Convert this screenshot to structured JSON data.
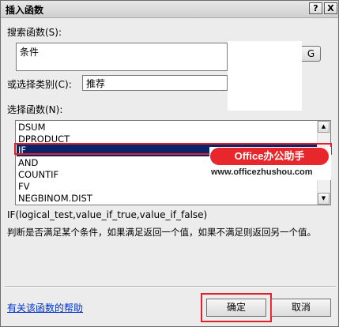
{
  "window": {
    "title": "插入函数",
    "help_glyph": "?",
    "close_glyph": "X"
  },
  "search": {
    "label": "搜索函数(S):",
    "value": "条件",
    "go_label": "G"
  },
  "category": {
    "label": "或选择类别(C):",
    "selected": "推荐"
  },
  "functions": {
    "label": "选择函数(N):",
    "items": [
      "DSUM",
      "DPRODUCT",
      "IF",
      "AND",
      "COUNTIF",
      "FV",
      "NEGBINOM.DIST"
    ],
    "selected": "IF"
  },
  "watermark": {
    "badge": "Office办公助手",
    "url": "www.officezhushou.com"
  },
  "syntax": "IF(logical_test,value_if_true,value_if_false)",
  "description": "判断是否满足某个条件，如果满足返回一个值，如果不满足则返回另一个值。",
  "footer": {
    "help_link": "有关该函数的帮助",
    "ok_label": "确定",
    "cancel_label": "取消"
  },
  "colors": {
    "selection": "#0a246a",
    "highlight": "#e0202a",
    "watermark_badge": "#e8272d",
    "link": "#0033cc"
  }
}
